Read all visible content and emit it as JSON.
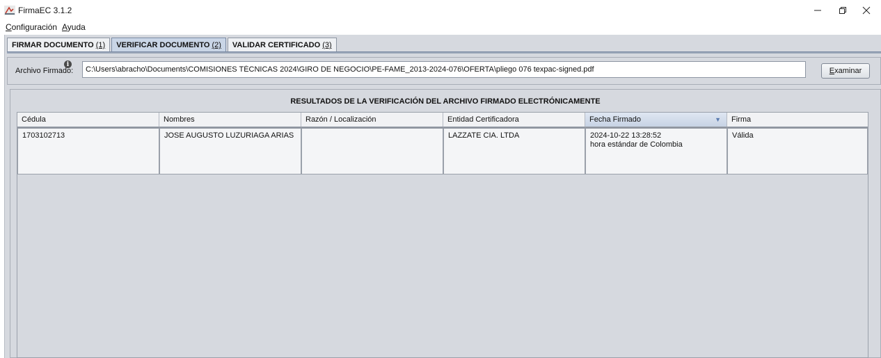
{
  "window": {
    "title": "FirmaEC 3.1.2"
  },
  "menu": [
    {
      "mnemonic": "C",
      "rest": "onfiguración"
    },
    {
      "mnemonic": "A",
      "rest": "yuda"
    }
  ],
  "tabs": [
    {
      "label": "FIRMAR DOCUMENTO",
      "shortcut": "(1)",
      "active": false
    },
    {
      "label": "VERIFICAR DOCUMENTO",
      "shortcut": "(2)",
      "active": true
    },
    {
      "label": "VALIDAR CERTIFICADO",
      "shortcut": "(3)",
      "active": false
    }
  ],
  "file": {
    "label": "Archivo Firmado:",
    "info_glyph": "i",
    "value": "C:\\Users\\abracho\\Documents\\COMISIONES TÉCNICAS 2024\\GIRO DE NEGOCIO\\PE-FAME_2013-2024-076\\OFERTA\\pliego 076 texpac-signed.pdf",
    "browse_mnemonic": "E",
    "browse_rest": "xaminar"
  },
  "results": {
    "title": "RESULTADOS DE LA VERIFICACIÓN DEL ARCHIVO FIRMADO ELECTRÓNICAMENTE",
    "columns": [
      "Cédula",
      "Nombres",
      "Razón / Localización",
      "Entidad Certificadora",
      "Fecha Firmado",
      "Firma"
    ],
    "sort_glyph": "▼",
    "rows": [
      {
        "cedula": "1703102713",
        "nombres": "JOSE AUGUSTO LUZURIAGA ARIAS",
        "razon": "",
        "entidad": "LAZZATE CIA. LTDA",
        "fecha_line1": "2024-10-22 13:28:52",
        "fecha_line2": "hora estándar de Colombia",
        "firma": "Válida"
      }
    ]
  }
}
